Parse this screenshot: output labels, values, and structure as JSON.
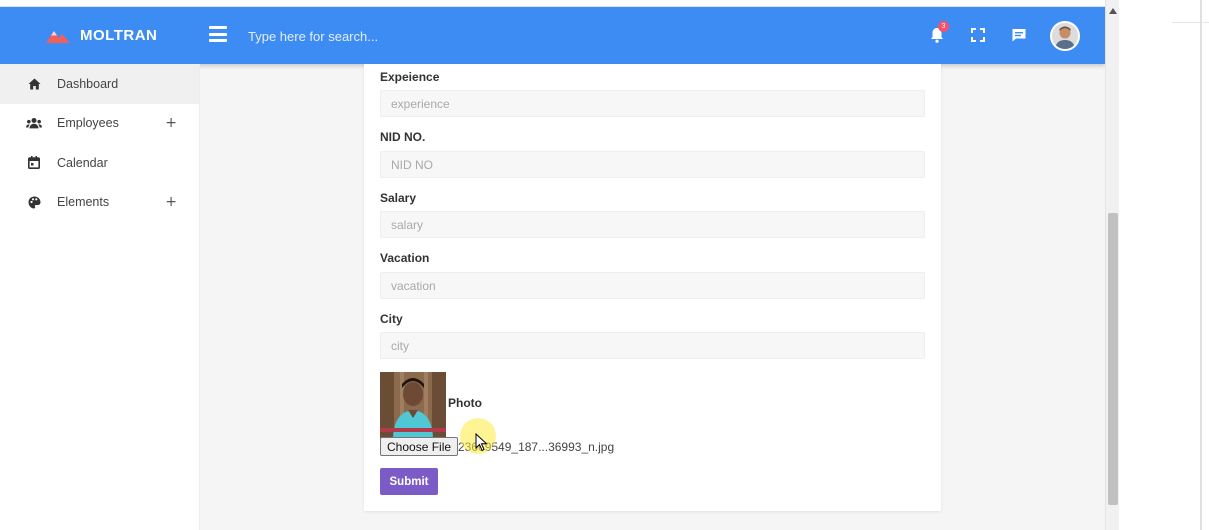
{
  "brand": {
    "name": "MOLTRAN"
  },
  "header": {
    "search_placeholder": "Type here for search...",
    "notification_count": "3"
  },
  "sidebar": {
    "items": [
      {
        "label": "Dashboard",
        "icon": "home-icon",
        "expandable": false,
        "active": true
      },
      {
        "label": "Employees",
        "icon": "users-icon",
        "expandable": true,
        "active": false
      },
      {
        "label": "Calendar",
        "icon": "calendar-icon",
        "expandable": false,
        "active": false
      },
      {
        "label": "Elements",
        "icon": "palette-icon",
        "expandable": true,
        "active": false
      }
    ],
    "expand_symbol": "+"
  },
  "form": {
    "fields": [
      {
        "label": "Expeience",
        "placeholder": "experience"
      },
      {
        "label": "NID NO.",
        "placeholder": "NID NO"
      },
      {
        "label": "Salary",
        "placeholder": "salary"
      },
      {
        "label": "Vacation",
        "placeholder": "vacation"
      },
      {
        "label": "City",
        "placeholder": "city"
      }
    ],
    "photo_label": "Photo",
    "choose_file_label": "Choose File",
    "file_name": "23669549_187...36993_n.jpg",
    "submit_label": "Submit"
  },
  "colors": {
    "header_bg": "#3d8cf3",
    "submit_bg": "#7b5cc6",
    "badge_bg": "#f4516c",
    "logo_red": "#f0615c"
  }
}
